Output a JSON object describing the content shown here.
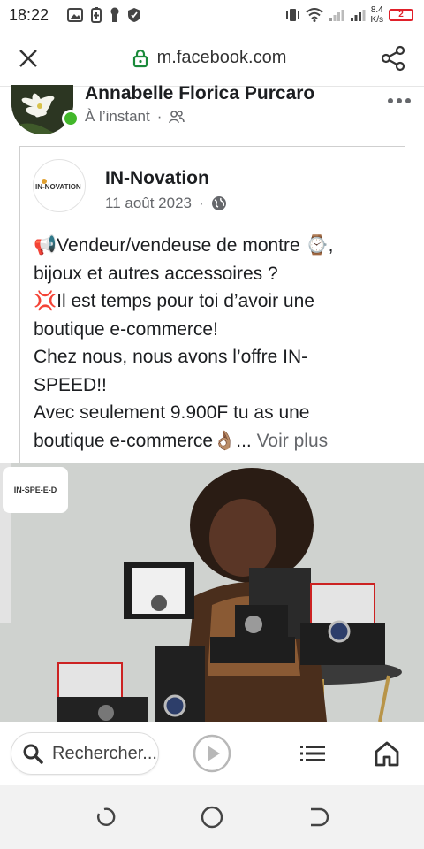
{
  "status_bar": {
    "time": "18:22",
    "net_speed_value": "8.4",
    "net_speed_unit": "K/s",
    "battery_level": "2"
  },
  "url_bar": {
    "url": "m.facebook.com"
  },
  "post": {
    "author": "Annabelle Florica Purcaro",
    "timestamp": "À l’instant",
    "separator": "·"
  },
  "shared": {
    "page_logo_text": "IN-NOVATION",
    "page_name": "IN-Novation",
    "date": "11 août 2023",
    "separator": "·",
    "lines": [
      "📢Vendeur/vendeuse de montre ⌚,",
      "bijoux et autres accessoires ?",
      "💢Il est temps pour toi d’avoir une",
      "boutique e-commerce!",
      "Chez nous, nous avons l’offre IN-",
      "SPEED!!",
      "Avec seulement 9.900F tu as une",
      "boutique e-commerce👌🏽..."
    ],
    "see_more": " Voir plus",
    "badge_text": "IN-SPE-E-D"
  },
  "bottom_bar": {
    "search_placeholder": "Rechercher..."
  },
  "colors": {
    "online": "#42b72a",
    "battery_low": "#e0202a",
    "lock": "#1a8a3a"
  }
}
